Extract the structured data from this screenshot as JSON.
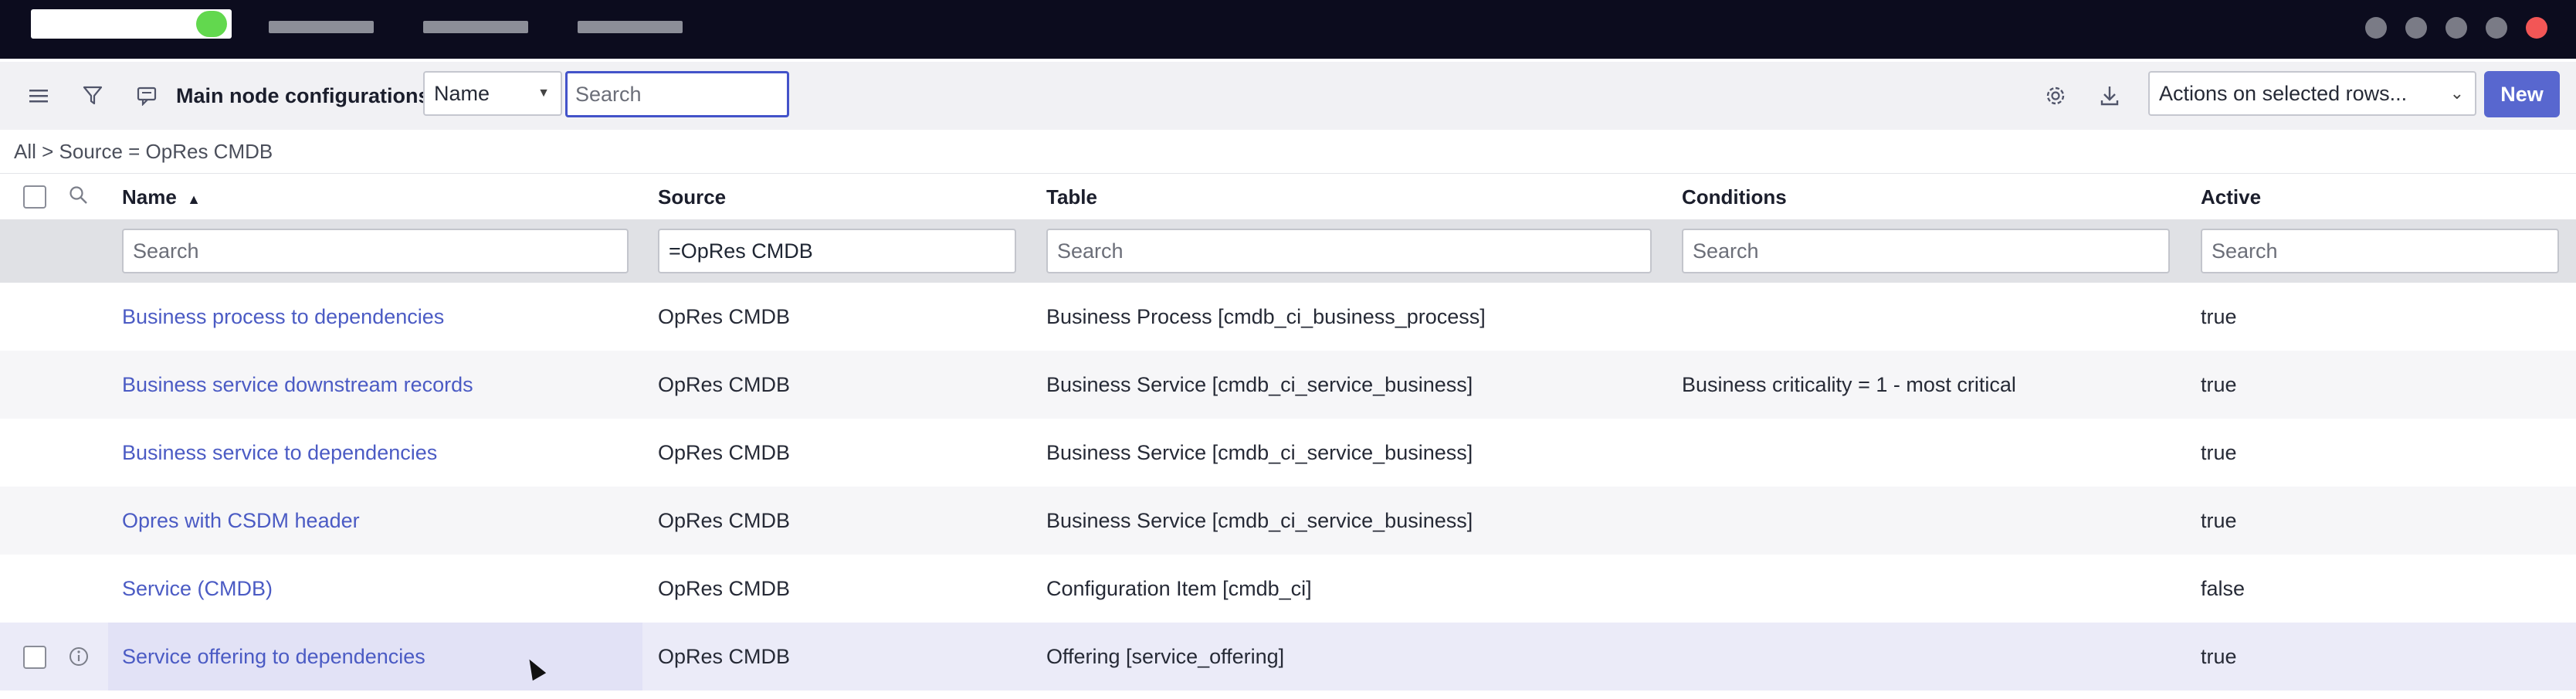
{
  "app": {
    "list_title": "Main node configurations"
  },
  "toolbar": {
    "search_field_select": "Name",
    "search_placeholder": "Search",
    "actions_select": "Actions on selected rows...",
    "new_button": "New"
  },
  "breadcrumb": "All > Source = OpRes CMDB",
  "columns": [
    {
      "key": "name",
      "label": "Name"
    },
    {
      "key": "source",
      "label": "Source"
    },
    {
      "key": "table",
      "label": "Table"
    },
    {
      "key": "conditions",
      "label": "Conditions"
    },
    {
      "key": "active",
      "label": "Active"
    }
  ],
  "sort": {
    "column": "Name",
    "direction": "ascending",
    "indicator": "▲"
  },
  "filters": {
    "name": "Search",
    "source": "=OpRes CMDB",
    "table": "Search",
    "conditions": "Search",
    "active": "Search"
  },
  "rows": [
    {
      "name": "Business process to dependencies",
      "source": "OpRes CMDB",
      "table": "Business Process [cmdb_ci_business_process]",
      "conditions": "",
      "active": "true"
    },
    {
      "name": "Business service downstream records",
      "source": "OpRes CMDB",
      "table": "Business Service [cmdb_ci_service_business]",
      "conditions": "Business criticality = 1 - most critical",
      "active": "true"
    },
    {
      "name": "Business service to dependencies",
      "source": "OpRes CMDB",
      "table": "Business Service [cmdb_ci_service_business]",
      "conditions": "",
      "active": "true"
    },
    {
      "name": "Opres with CSDM header",
      "source": "OpRes CMDB",
      "table": "Business Service [cmdb_ci_service_business]",
      "conditions": "",
      "active": "true"
    },
    {
      "name": "Service (CMDB)",
      "source": "OpRes CMDB",
      "table": "Configuration Item [cmdb_ci]",
      "conditions": "",
      "active": "false"
    },
    {
      "name": "Service offering to dependencies",
      "source": "OpRes CMDB",
      "table": "Offering [service_offering]",
      "conditions": "",
      "active": "true"
    }
  ],
  "colors": {
    "topbar": "#0c0c1e",
    "accent": "#5867cf",
    "link": "#4b5bc4",
    "status_green": "#62d84e",
    "close_red": "#f25656"
  },
  "icons": {
    "menu": "hamburger-icon",
    "filter": "funnel-icon",
    "context": "message-icon",
    "settings": "gear-icon",
    "export": "download-icon",
    "column_search": "search-icon",
    "row_info": "info-icon"
  }
}
